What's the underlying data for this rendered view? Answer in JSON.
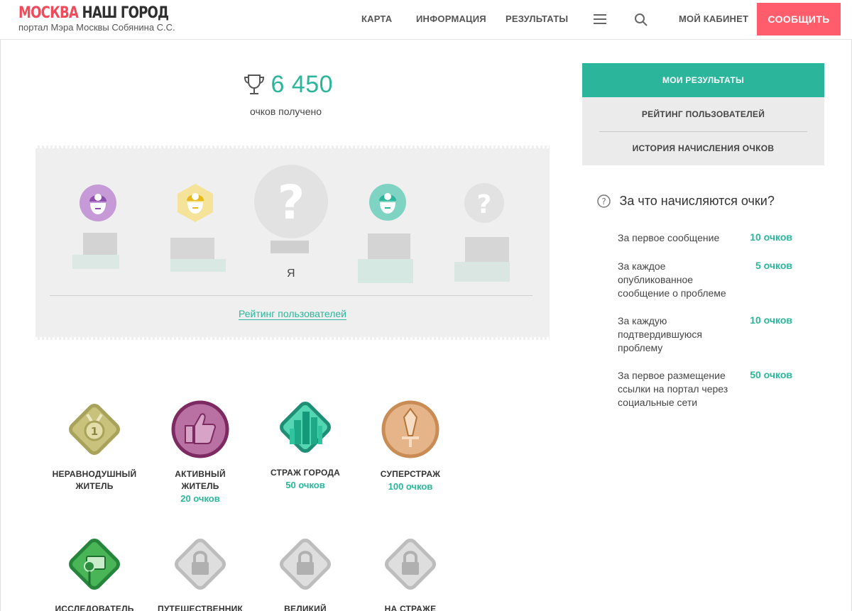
{
  "header": {
    "logo_part1": "МОСКВА",
    "logo_part2": "НАШ ГОРОД",
    "logo_subtitle": "портал Мэра Москвы Собянина С.С.",
    "nav": [
      "КАРТА",
      "ИНФОРМАЦИЯ",
      "РЕЗУЛЬТАТЫ"
    ],
    "cabinet": "МОЙ КАБИНЕТ",
    "report_button": "СООБЩИТЬ"
  },
  "score": {
    "value": "6 450",
    "label": "очков получено"
  },
  "board": {
    "me_label": "Я",
    "link": "Рейтинг пользователей"
  },
  "badges": [
    {
      "title": "НЕРАВНОДУШНЫЙ\nЖИТЕЛЬ",
      "points": ""
    },
    {
      "title": "АКТИВНЫЙ\nЖИТЕЛЬ",
      "points": "20 очков"
    },
    {
      "title": "СТРАЖ ГОРОДА",
      "points": "50 очков"
    },
    {
      "title": "СУПЕРСТРАЖ",
      "points": "100 очков"
    },
    {
      "title": "ИССЛЕДОВАТЕЛЬ",
      "points": ""
    },
    {
      "title": "ПУТЕШЕСТВЕННИК",
      "points": ""
    },
    {
      "title": "ВЕЛИКИЙ",
      "points": ""
    },
    {
      "title": "НА СТРАЖЕ",
      "points": ""
    }
  ],
  "tabs": [
    "МОИ РЕЗУЛЬТАТЫ",
    "РЕЙТИНГ ПОЛЬЗОВАТЕЛЕЙ",
    "ИСТОРИЯ НАЧИСЛЕНИЯ ОЧКОВ"
  ],
  "info": {
    "title": "За что начисляются очки?",
    "rows": [
      {
        "text": "За первое сообщение",
        "points": "10 очков"
      },
      {
        "text": "За каждое опубликованное сообщение о проблеме",
        "points": "5 очков"
      },
      {
        "text": "За каждую подтвердившуюся проблему",
        "points": "10 очков"
      },
      {
        "text": "За первое размещение ссылки на портал через социальные сети",
        "points": "50 очков"
      }
    ]
  },
  "colors": {
    "accent": "#2bb69b",
    "brand_red": "#ef4b5b",
    "button_red": "#ff5d6b"
  },
  "icons": [
    "menu-icon",
    "search-icon",
    "trophy-icon",
    "help-icon",
    "avatar-icon",
    "question-icon",
    "medal-icon",
    "thumbs-up-icon",
    "city-icon",
    "sword-icon",
    "camera-icon",
    "lock-icon"
  ]
}
